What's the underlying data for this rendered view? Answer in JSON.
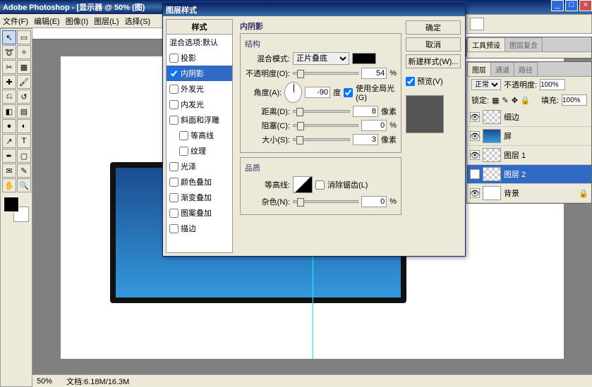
{
  "app": {
    "title": "Adobe Photoshop - [显示器 @ 50% (图)"
  },
  "menu": [
    "文件(F)",
    "编辑(E)",
    "图像(I)",
    "图层(L)",
    "选择(S)"
  ],
  "dialog": {
    "title": "图层样式",
    "styleHeader": "样式",
    "blendDefault": "混合选项:默认",
    "styles": [
      "投影",
      "内阴影",
      "外发光",
      "内发光",
      "斜面和浮雕",
      "等高线",
      "纹理",
      "光泽",
      "颜色叠加",
      "渐变叠加",
      "图案叠加",
      "描边"
    ],
    "section": "内阴影",
    "group1": "结构",
    "group2": "品质",
    "blendModeLbl": "混合模式:",
    "blendMode": "正片叠底",
    "opacityLbl": "不透明度(O):",
    "opacity": "54",
    "angleLbl": "角度(A):",
    "angle": "-90",
    "angleUnit": "度",
    "globalLight": "使用全局光(G)",
    "distanceLbl": "距离(D):",
    "distance": "8",
    "px": "像素",
    "chokeLbl": "阻塞(C):",
    "choke": "0",
    "pct": "%",
    "sizeLbl": "大小(S):",
    "size": "3",
    "contourLbl": "等高线:",
    "antiAlias": "消除锯齿(L)",
    "noiseLbl": "杂色(N):",
    "noise": "0",
    "ok": "确定",
    "cancel": "取消",
    "newStyle": "新建样式(W)...",
    "preview": "预览(V)"
  },
  "panels": {
    "toolPresets": "工具预设",
    "layerComps": "图层复合",
    "layersTab": "图层",
    "channelsTab": "通道",
    "pathsTab": "路径",
    "mode": "正常",
    "opacityLbl": "不透明度:",
    "opacity": "100%",
    "lockLbl": "锁定:",
    "fillLbl": "填充:",
    "fill": "100%",
    "layers": [
      "细边",
      "屏",
      "图层 1",
      "图层 2",
      "背景"
    ]
  },
  "status": {
    "zoom": "50%",
    "doc": "文档:6.18M/16.3M"
  }
}
